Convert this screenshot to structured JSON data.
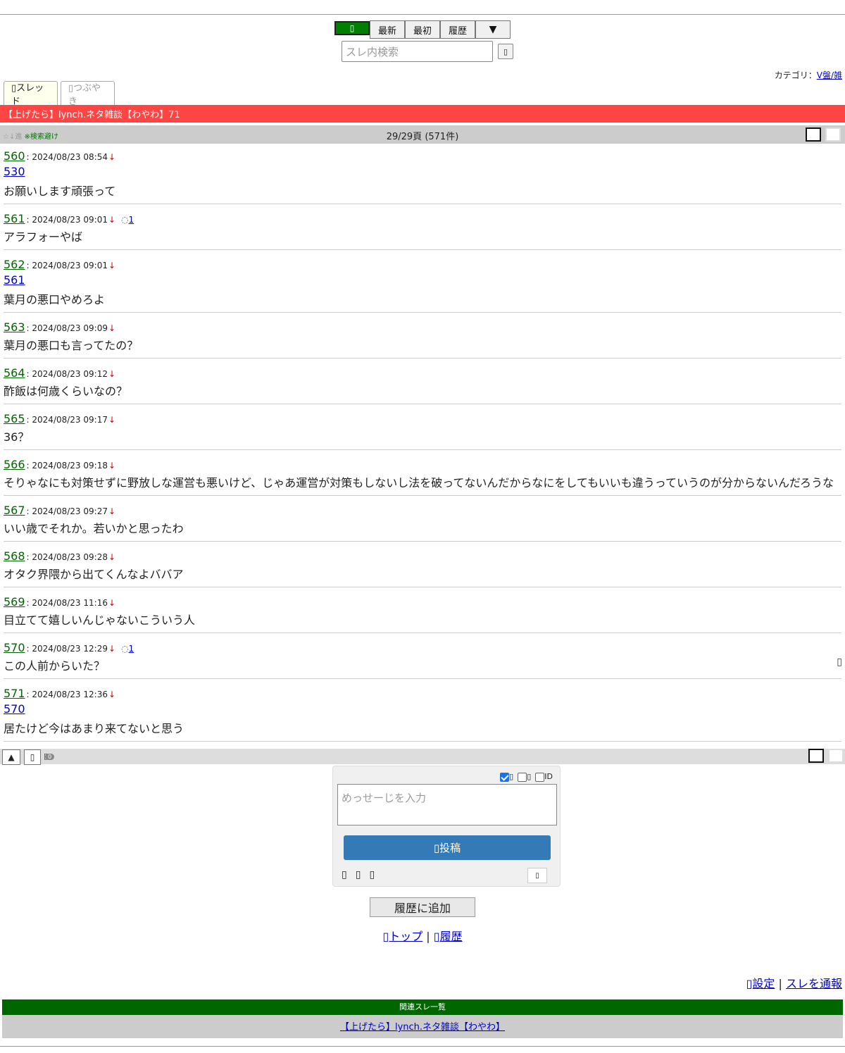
{
  "nav": {
    "home_glyph": "▯",
    "latest": "最新",
    "first": "最初",
    "history": "履歴",
    "menu": "▼"
  },
  "search": {
    "placeholder": "スレ内検索",
    "button_glyph": "▯"
  },
  "category": {
    "label": "カテゴリ：",
    "link": "V盤/雑"
  },
  "tabs": {
    "thread": "▯スレッド",
    "tweets": "▯つぶやき"
  },
  "thread_title": "【上げたら】lynch.ネタ雑談【わやわ】71",
  "page_bar": {
    "left_grey": "☆↓進 ",
    "left_green": "※検索避け",
    "page_info": "29/29頁 (571件)"
  },
  "posts": [
    {
      "num": "560",
      "date": ": 2024/08/23 08:54",
      "anchor": "530",
      "text": "お願いします頑張って"
    },
    {
      "num": "561",
      "date": ": 2024/08/23 09:01",
      "reply_count": "1",
      "text": "アラフォーやば"
    },
    {
      "num": "562",
      "date": ": 2024/08/23 09:01",
      "anchor": "561",
      "text": "葉月の悪口やめろよ"
    },
    {
      "num": "563",
      "date": ": 2024/08/23 09:09",
      "text": "葉月の悪口も言ってたの？"
    },
    {
      "num": "564",
      "date": ": 2024/08/23 09:12",
      "text": "酢飯は何歳くらいなの？"
    },
    {
      "num": "565",
      "date": ": 2024/08/23 09:17",
      "text": "36？"
    },
    {
      "num": "566",
      "date": ": 2024/08/23 09:18",
      "text": "そりゃなにも対策せずに野放しな運営も悪いけど、じゃあ運営が対策もしないし法を破ってないんだからなにをしてもいいも違うっていうのが分からないんだろうな"
    },
    {
      "num": "567",
      "date": ": 2024/08/23 09:27",
      "text": "いい歳でそれか。若いかと思ったわ"
    },
    {
      "num": "568",
      "date": ": 2024/08/23 09:28",
      "text": "オタク界隈から出てくんなよババア"
    },
    {
      "num": "569",
      "date": ": 2024/08/23 11:16",
      "text": "目立てて嬉しいんじゃないこういう人"
    },
    {
      "num": "570",
      "date": ": 2024/08/23 12:29",
      "reply_count": "1",
      "text": "この人前からいた？"
    },
    {
      "num": "571",
      "date": ": 2024/08/23 12:36",
      "anchor": "570",
      "text": "居たけど今はあまり来てないと思う"
    }
  ],
  "down_arrow": "↓",
  "reply_icon": "💬",
  "bottom_bar": {
    "up": "▲",
    "box": "▯",
    "badge": "0"
  },
  "form": {
    "check_id": "ID",
    "placeholder": "めっせーじを入力",
    "submit": "▯投稿"
  },
  "history_add": "履歴に追加",
  "footer": {
    "top": "▯トップ",
    "sep": " | ",
    "history": "▯履歴"
  },
  "settings": {
    "settings": "▯設定",
    "sep": " | ",
    "report": "スレを通報"
  },
  "related": {
    "header": "関連スレ一覧",
    "item": "【上げたら】lynch.ネタ雑談【わやわ】"
  }
}
